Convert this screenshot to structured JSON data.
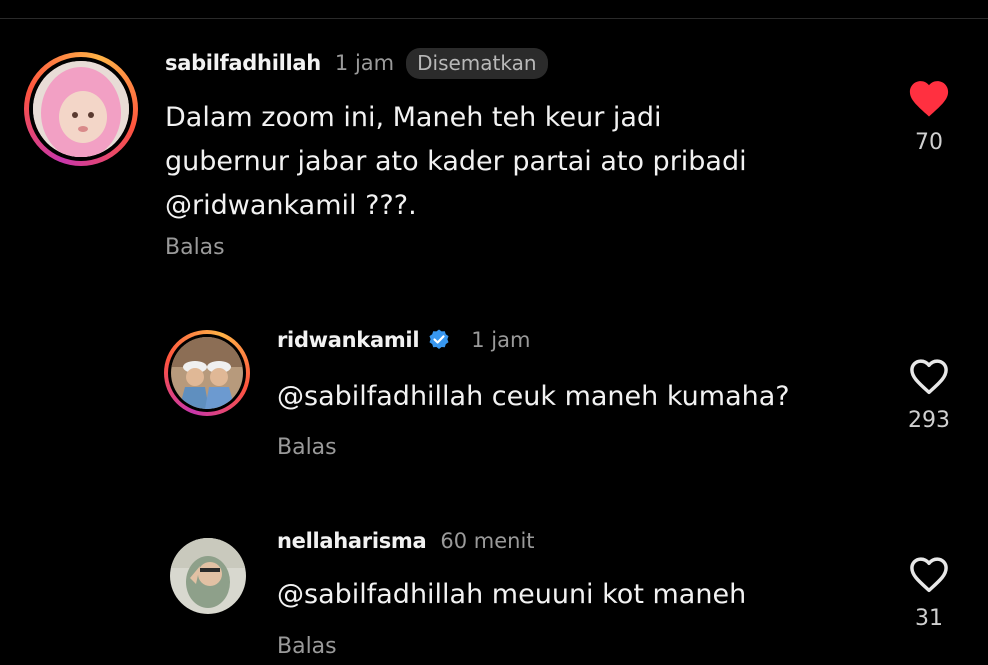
{
  "comments": [
    {
      "username": "sabilfadhillah",
      "time": "1 jam",
      "pinned_label": "Disematkan",
      "text": "Dalam zoom ini, Maneh teh keur jadi\ngubernur jabar ato kader partai ato pribadi\n@ridwankamil ???.",
      "reply_label": "Balas",
      "likes": "70",
      "liked": true
    },
    {
      "username": "ridwankamil",
      "verified": true,
      "time": "1 jam",
      "text": "@sabilfadhillah ceuk maneh kumaha?",
      "reply_label": "Balas",
      "likes": "293",
      "liked": false
    },
    {
      "username": "nellaharisma",
      "time": "60 menit",
      "text": "@sabilfadhillah meuuni kot maneh",
      "reply_label": "Balas",
      "likes": "31",
      "liked": false
    }
  ],
  "colors": {
    "background": "#000000",
    "like_active": "#ff3040",
    "verified_badge": "#3897f0",
    "muted_text": "#9a9a9a"
  },
  "icons": {
    "like_filled": "heart-filled-icon",
    "like_outline": "heart-outline-icon",
    "verified": "verified-badge-icon"
  }
}
